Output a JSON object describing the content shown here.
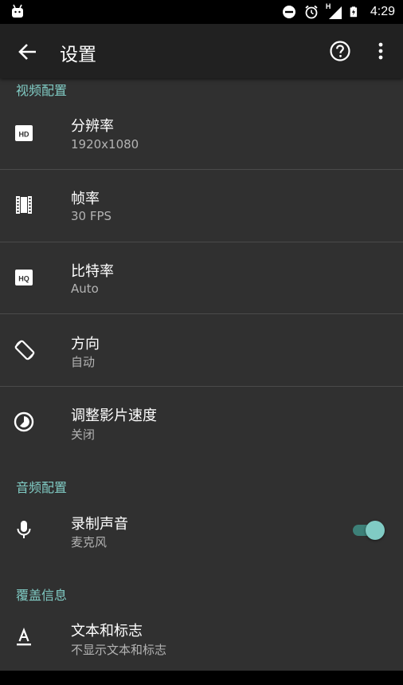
{
  "statusbar": {
    "time": "4:29",
    "network_label": "H"
  },
  "toolbar": {
    "title": "设置"
  },
  "sections": [
    {
      "header": "视频配置"
    },
    {
      "header": "音频配置"
    },
    {
      "header": "覆盖信息"
    }
  ],
  "video": {
    "resolution": {
      "title": "分辨率",
      "value": "1920x1080",
      "icon": "hd-icon"
    },
    "framerate": {
      "title": "帧率",
      "value": "30 FPS",
      "icon": "film-icon"
    },
    "bitrate": {
      "title": "比特率",
      "value": "Auto",
      "icon": "hq-icon"
    },
    "orientation": {
      "title": "方向",
      "value": "自动",
      "icon": "screen-rotation-icon"
    },
    "speed": {
      "title": "调整影片速度",
      "value": "关闭",
      "icon": "timelapse-icon"
    }
  },
  "audio": {
    "record": {
      "title": "录制声音",
      "value": "麦克风",
      "icon": "mic-icon",
      "enabled": true
    }
  },
  "overlay": {
    "text_logo": {
      "title": "文本和标志",
      "value": "不显示文本和标志",
      "icon": "text-format-icon"
    }
  },
  "colors": {
    "accent": "#80CBC4",
    "background": "#303030",
    "toolbar": "#212121"
  }
}
